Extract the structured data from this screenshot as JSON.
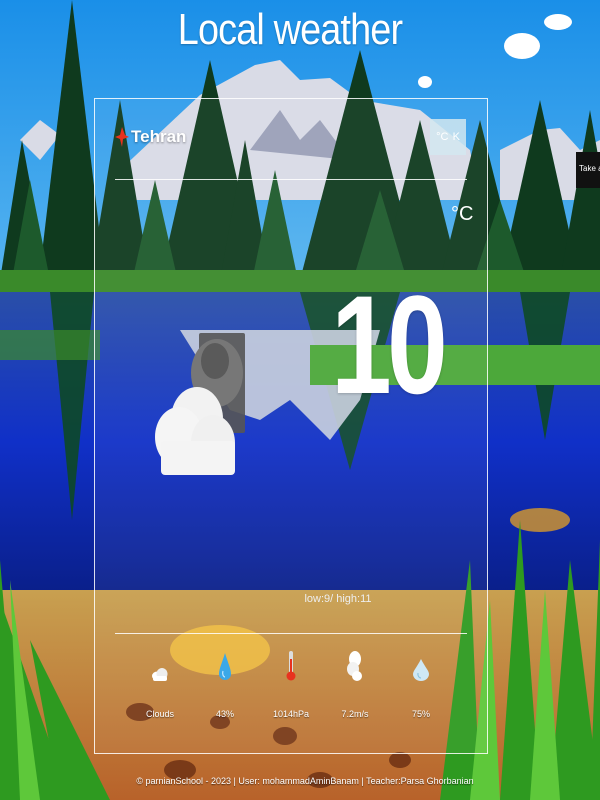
{
  "app": {
    "title": "Local weather"
  },
  "location": {
    "city": "Tehran"
  },
  "units": {
    "celsius_label": "°C",
    "kelvin_label": "K",
    "current_unit": "°C"
  },
  "current": {
    "temperature": "10",
    "low_high": "low:9/ high:11",
    "condition_icon": "cloudy-icon"
  },
  "stats": [
    {
      "icon": "cloud-icon",
      "label": "Clouds"
    },
    {
      "icon": "raindrop-icon",
      "label": "43%"
    },
    {
      "icon": "thermometer-icon",
      "label": "1014hPa"
    },
    {
      "icon": "wind-icon",
      "label": "7.2m/s"
    },
    {
      "icon": "humidity-icon",
      "label": "75%"
    }
  ],
  "side_hint": {
    "text": "Take a s"
  },
  "footer": {
    "text": "© parnianSchool - 2023 | User: mohammadAminBanam | Teacher:Parsa Ghorbanian"
  },
  "colors": {
    "pin": "#e8321f",
    "sky": "#1a8fe8",
    "accent_toggle": "#d2e8f0"
  }
}
